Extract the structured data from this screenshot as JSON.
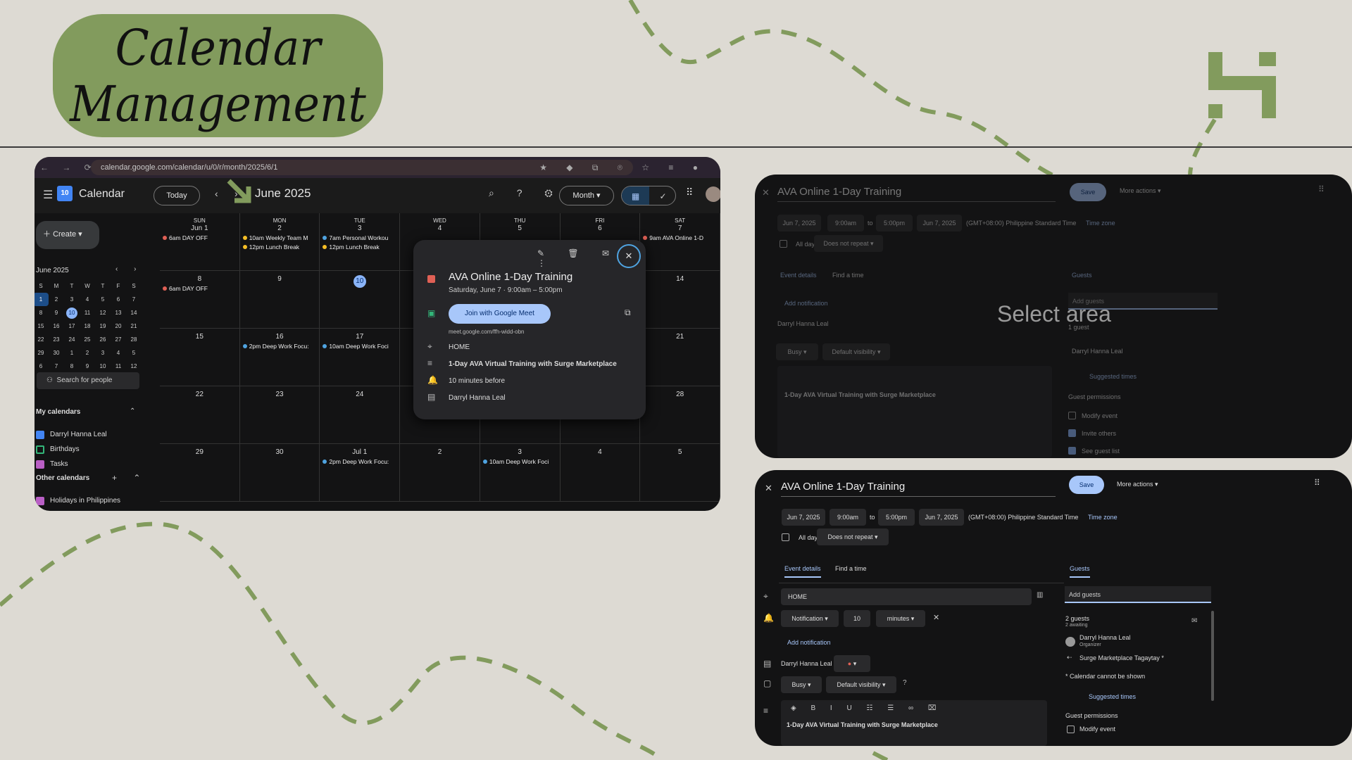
{
  "title": {
    "line1": "Calendar",
    "line2": "Management"
  },
  "browser": {
    "url": "calendar.google.com/calendar/u/0/r/month/2025/6/1"
  },
  "calendar": {
    "logo_day": "10",
    "app_name": "Calendar",
    "today_button": "Today",
    "month_title": "June 2025",
    "view_select": "Month",
    "create_button": "Create",
    "mini_month": "June 2025",
    "mini_weekdays": [
      "S",
      "M",
      "T",
      "W",
      "T",
      "F",
      "S"
    ],
    "mini_weeks": [
      [
        "1",
        "2",
        "3",
        "4",
        "5",
        "6",
        "7"
      ],
      [
        "8",
        "9",
        "10",
        "11",
        "12",
        "13",
        "14"
      ],
      [
        "15",
        "16",
        "17",
        "18",
        "19",
        "20",
        "21"
      ],
      [
        "22",
        "23",
        "24",
        "25",
        "26",
        "27",
        "28"
      ],
      [
        "29",
        "30",
        "1",
        "2",
        "3",
        "4",
        "5"
      ],
      [
        "6",
        "7",
        "8",
        "9",
        "10",
        "11",
        "12"
      ]
    ],
    "search_people": "Search for people",
    "my_calendars_heading": "My calendars",
    "my_calendars": [
      "Darryl Hanna Leal",
      "Birthdays",
      "Tasks"
    ],
    "other_calendars_heading": "Other calendars",
    "other_calendars": [
      "Holidays in Philippines"
    ],
    "weekdays": [
      "SUN",
      "MON",
      "TUE",
      "WED",
      "THU",
      "FRI",
      "SAT"
    ],
    "grid": [
      [
        {
          "d": "Jun 1",
          "e": [
            "6am DAY OFF"
          ]
        },
        {
          "d": "2",
          "e": [
            "10am Weekly Team M",
            "12pm Lunch Break"
          ]
        },
        {
          "d": "3",
          "e": [
            "7am Personal Workou",
            "12pm Lunch Break"
          ]
        },
        {
          "d": "4",
          "e": []
        },
        {
          "d": "5",
          "e": []
        },
        {
          "d": "6",
          "e": []
        },
        {
          "d": "7",
          "e": [
            "9am AVA Online 1-D"
          ]
        }
      ],
      [
        {
          "d": "8",
          "e": [
            "6am DAY OFF"
          ]
        },
        {
          "d": "9",
          "e": []
        },
        {
          "d": "10",
          "e": []
        },
        {
          "d": "11",
          "e": []
        },
        {
          "d": "12",
          "e": []
        },
        {
          "d": "13",
          "e": []
        },
        {
          "d": "14",
          "e": []
        }
      ],
      [
        {
          "d": "15",
          "e": []
        },
        {
          "d": "16",
          "e": [
            "2pm Deep Work Focu:"
          ]
        },
        {
          "d": "17",
          "e": [
            "10am Deep Work Foci"
          ]
        },
        {
          "d": "18",
          "e": []
        },
        {
          "d": "19",
          "e": []
        },
        {
          "d": "20",
          "e": []
        },
        {
          "d": "21",
          "e": []
        }
      ],
      [
        {
          "d": "22",
          "e": []
        },
        {
          "d": "23",
          "e": []
        },
        {
          "d": "24",
          "e": []
        },
        {
          "d": "25",
          "e": []
        },
        {
          "d": "26",
          "e": []
        },
        {
          "d": "27",
          "e": []
        },
        {
          "d": "28",
          "e": []
        }
      ],
      [
        {
          "d": "29",
          "e": []
        },
        {
          "d": "30",
          "e": []
        },
        {
          "d": "Jul 1",
          "e": [
            "2pm Deep Work Focu:"
          ]
        },
        {
          "d": "2",
          "e": []
        },
        {
          "d": "3",
          "e": [
            "10am Deep Work Foci"
          ]
        },
        {
          "d": "4",
          "e": []
        },
        {
          "d": "5",
          "e": []
        }
      ]
    ],
    "popup": {
      "title": "AVA Online 1-Day Training",
      "when": "Saturday, June 7  ·  9:00am – 5:00pm",
      "meet_button": "Join with Google Meet",
      "meet_link": "meet.google.com/ffh-widd-obn",
      "location": "HOME",
      "description": "1-Day AVA Virtual Training with Surge Marketplace",
      "reminder": "10 minutes before",
      "owner": "Darryl Hanna Leal"
    }
  },
  "edit_top": {
    "title": "AVA Online 1-Day Training",
    "save": "Save",
    "more_actions": "More actions",
    "start_date": "Jun 7, 2025",
    "start_time": "9:00am",
    "to": "to",
    "end_time": "5:00pm",
    "end_date": "Jun 7, 2025",
    "tz_text": "(GMT+08:00) Philippine Standard Time",
    "tz_link": "Time zone",
    "all_day": "All day",
    "repeat": "Does not repeat",
    "tab_details": "Event details",
    "tab_find": "Find a time",
    "tab_guests": "Guests",
    "add_notification": "Add notification",
    "owner": "Darryl Hanna Leal",
    "busy": "Busy",
    "visibility": "Default visibility",
    "description": "1-Day AVA Virtual Training with Surge Marketplace",
    "add_guests": "Add guests",
    "overlay": "Select area",
    "guest_count": "1 guest",
    "guest_awaiting": "1 awaiting",
    "guest1": "Darryl Hanna Leal",
    "guest1_role": "Organizer",
    "suggested": "Suggested times",
    "permissions": "Guest permissions",
    "perm": [
      "Modify event",
      "Invite others",
      "See guest list"
    ]
  },
  "edit_bottom": {
    "title": "AVA Online 1-Day Training",
    "save": "Save",
    "more_actions": "More actions",
    "start_date": "Jun 7, 2025",
    "start_time": "9:00am",
    "to": "to",
    "end_time": "5:00pm",
    "end_date": "Jun 7, 2025",
    "tz_text": "(GMT+08:00) Philippine Standard Time",
    "tz_link": "Time zone",
    "all_day": "All day",
    "repeat": "Does not repeat",
    "tab_details": "Event details",
    "tab_find": "Find a time",
    "tab_guests": "Guests",
    "location": "HOME",
    "notif_type": "Notification",
    "notif_value": "10",
    "notif_unit": "minutes",
    "add_notification": "Add notification",
    "owner": "Darryl Hanna Leal",
    "busy": "Busy",
    "visibility": "Default visibility",
    "description": "1-Day AVA Virtual Training with Surge Marketplace",
    "add_guests": "Add guests",
    "guest_count": "2 guests",
    "guest_awaiting": "2 awaiting",
    "guest1": "Darryl Hanna Leal",
    "guest1_role": "Organizer",
    "guest2": "Surge Marketplace Tagaytay *",
    "cal_note": "* Calendar cannot be shown",
    "suggested": "Suggested times",
    "permissions": "Guest permissions",
    "perm1": "Modify event"
  },
  "colors": {
    "background": "#dddad3",
    "accent_green": "#829b5d",
    "event_red": "#e06055",
    "event_orange": "#f6bf26",
    "event_blue": "#4fa3e0",
    "event_green": "#33b679"
  }
}
